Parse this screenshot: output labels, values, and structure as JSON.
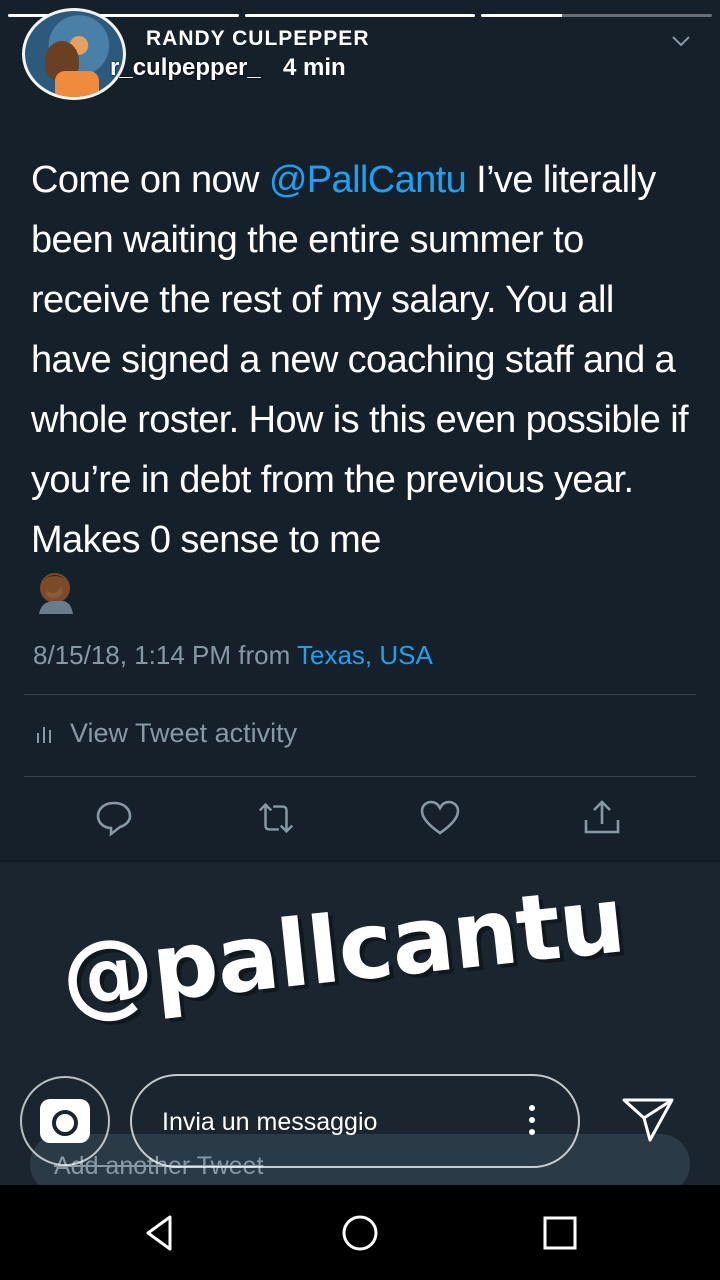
{
  "story": {
    "display_name": "RANDY CULPEPPER",
    "username": "r_culpepper_",
    "time_ago": "4 min",
    "progress": [
      1.0,
      1.0,
      0.35,
      0.0
    ],
    "reply_placeholder": "Invia un messaggio"
  },
  "tweet": {
    "text_before": "Come on now ",
    "mention": "@PallCantu",
    "text_after": " I’ve literally been waiting the entire summer to receive the rest of my salary. You all have signed a new coaching staff and a whole roster. How is this even possible if you’re in debt from the previous year. Makes 0  sense to me",
    "timestamp": "8/15/18, 1:14 PM from ",
    "location": "Texas, USA",
    "activity_label": "View Tweet activity",
    "compose_placeholder": "Add another Tweet"
  },
  "sticker": {
    "text": "@pallcantu"
  },
  "icons": {
    "reply": "comment-icon",
    "retweet": "retweet-icon",
    "like": "heart-icon",
    "share": "share-icon",
    "camera": "camera-icon",
    "more": "more-vertical-icon",
    "send": "send-icon",
    "back": "back-icon",
    "home": "home-icon",
    "recents": "recents-icon"
  },
  "colors": {
    "background": "#15202b",
    "accent": "#1da1f2",
    "secondary_text": "#8899a6"
  }
}
